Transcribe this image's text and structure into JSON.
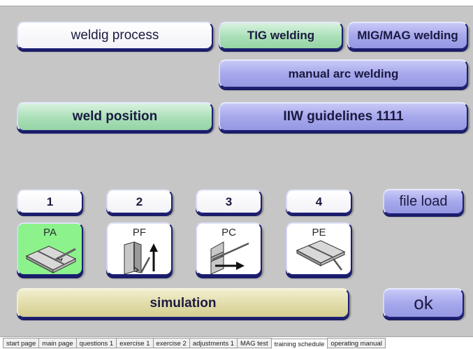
{
  "process": {
    "label": "weldig process",
    "tig": "TIG welding",
    "mig_mag": "MIG/MAG welding",
    "manual_arc": "manual arc welding"
  },
  "position": {
    "label": "weld position",
    "guidelines": "IIW guidelines 1111"
  },
  "numbers": [
    "1",
    "2",
    "3",
    "4"
  ],
  "positions": [
    {
      "label": "PA",
      "icon": "flat-weld-icon",
      "active": true
    },
    {
      "label": "PF",
      "icon": "vertical-up-weld-icon",
      "active": false
    },
    {
      "label": "PC",
      "icon": "horizontal-weld-icon",
      "active": false
    },
    {
      "label": "PE",
      "icon": "overhead-weld-icon",
      "active": false
    }
  ],
  "file_load": "file load",
  "simulation": "simulation",
  "ok": "ok",
  "tabs": [
    "start page",
    "main page",
    "questions 1",
    "exercise 1",
    "exercise 2",
    "adjustments 1",
    "MAG test",
    "training schedule",
    "operating manual"
  ],
  "active_tab": "training schedule",
  "colors": {
    "background": "#c6c6c6",
    "blue_button": "#a7a8ec",
    "green_button": "#a9dfb7",
    "khaki_button": "#e1dca8",
    "active_tile": "#8cf28c"
  }
}
